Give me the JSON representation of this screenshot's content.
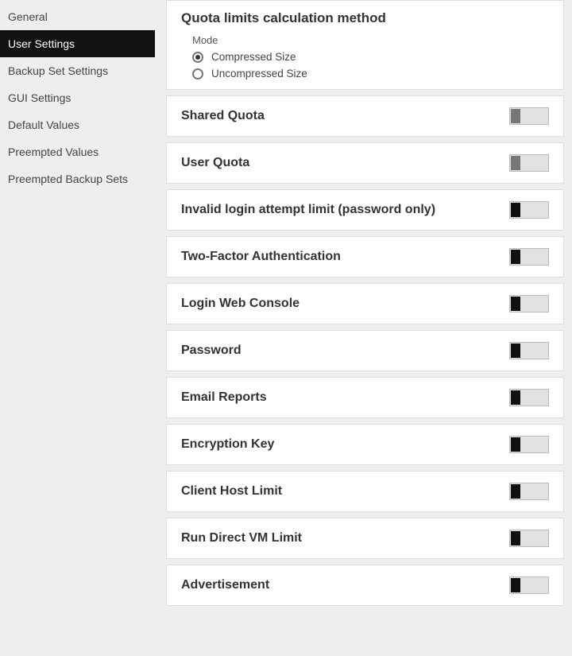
{
  "sidebar": {
    "items": [
      {
        "label": "General"
      },
      {
        "label": "User Settings"
      },
      {
        "label": "Backup Set Settings"
      },
      {
        "label": "GUI Settings"
      },
      {
        "label": "Default Values"
      },
      {
        "label": "Preempted Values"
      },
      {
        "label": "Preempted Backup Sets"
      }
    ]
  },
  "quota": {
    "title": "Quota limits calculation method",
    "mode_label": "Mode",
    "options": [
      {
        "label": "Compressed Size"
      },
      {
        "label": "Uncompressed Size"
      }
    ]
  },
  "panels": [
    {
      "title": "Shared Quota"
    },
    {
      "title": "User Quota"
    },
    {
      "title": "Invalid login attempt limit (password only)"
    },
    {
      "title": "Two-Factor Authentication"
    },
    {
      "title": "Login Web Console"
    },
    {
      "title": "Password"
    },
    {
      "title": "Email Reports"
    },
    {
      "title": "Encryption Key"
    },
    {
      "title": "Client Host Limit"
    },
    {
      "title": "Run Direct VM Limit"
    },
    {
      "title": "Advertisement"
    }
  ]
}
